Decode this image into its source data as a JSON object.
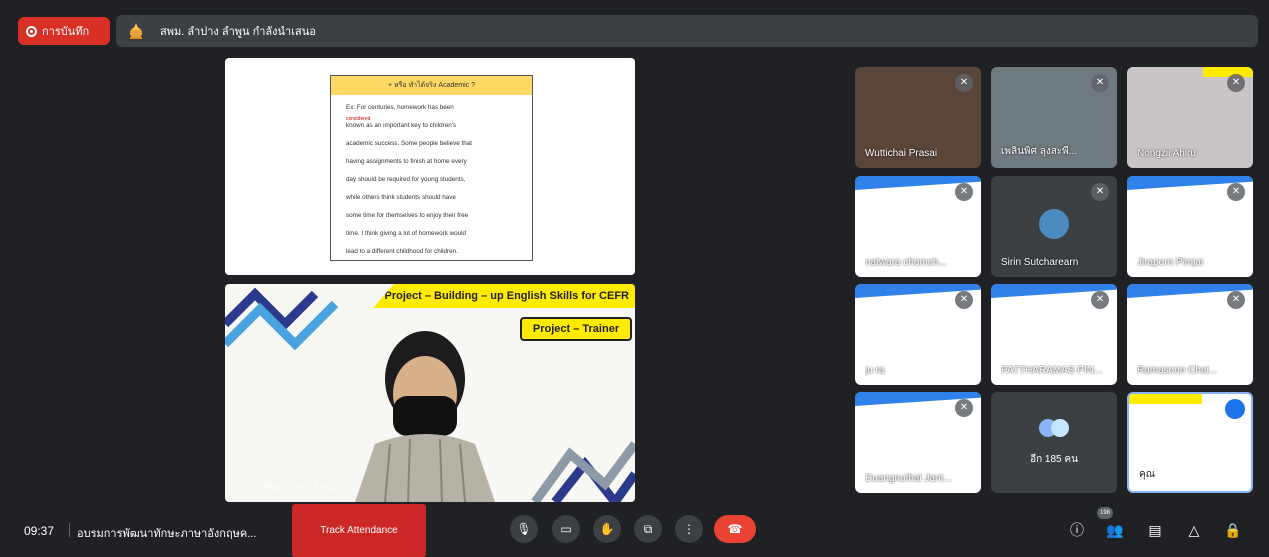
{
  "recording": {
    "label": "การบันทึก"
  },
  "presenter_bar": {
    "text": "สพม. ลำปาง ลำพูน กำลังนำเสนอ"
  },
  "slide": {
    "title": "+ หรือ ทำได้จริง Academic ?",
    "lines": [
      "Ex: For centuries, homework has been",
      "known as an important key to children's",
      "academic success. Some people believe that",
      "having assignments to finish at home every",
      "day should be required for young students,",
      "while others think students should have",
      "some time for themselves to enjoy their free",
      "time. I think giving a lot of homework would",
      "lead to a different childhood for children."
    ]
  },
  "camera": {
    "banner": "Project – Building – up English Skills for CEFR",
    "badge": "Project – Trainer",
    "name": "สพม. ลำปาง ลำพูน"
  },
  "tiles": [
    {
      "name": "Wuttichai Prasai",
      "muted": true
    },
    {
      "name": "เพลินพิศ ลุงสะพี...",
      "muted": true
    },
    {
      "name": "Nongzii Ahiru",
      "muted": true
    },
    {
      "name": "natwara chomch...",
      "muted": true
    },
    {
      "name": "Sirin Sutcharearn",
      "muted": true
    },
    {
      "name": "Jiraporn Pimjai",
      "muted": true
    },
    {
      "name": "ju ra",
      "muted": true
    },
    {
      "name": "PATTHARAMAS PIN...",
      "muted": true
    },
    {
      "name": "Ramasoon Chai...",
      "muted": true
    },
    {
      "name": "Duangnuthai Jant...",
      "muted": true
    },
    {
      "name": "",
      "muted": false
    },
    {
      "name": "คุณ",
      "muted": false
    }
  ],
  "others": {
    "count_label": "อีก 185 คน"
  },
  "bottom": {
    "time": "09:37",
    "meeting_name": "อบรมการพัฒนาทักษะภาษาอังกฤษค...",
    "track_attendance": "Track Attendance",
    "participants_count": "198"
  },
  "icons": {
    "mic": "microphone-icon",
    "cam": "camera-icon",
    "hand": "raise-hand-icon",
    "present": "present-screen-icon",
    "more": "more-options-icon",
    "leave": "hang-up-icon",
    "info": "info-icon",
    "people": "people-icon",
    "chat": "chat-icon",
    "activities": "activities-icon",
    "host": "host-controls-icon"
  },
  "colors": {
    "record": "#d93025",
    "hangup": "#ea4335",
    "track": "#cc2727",
    "banner": "#ffeb00",
    "speaking": "#8ab4f8"
  }
}
